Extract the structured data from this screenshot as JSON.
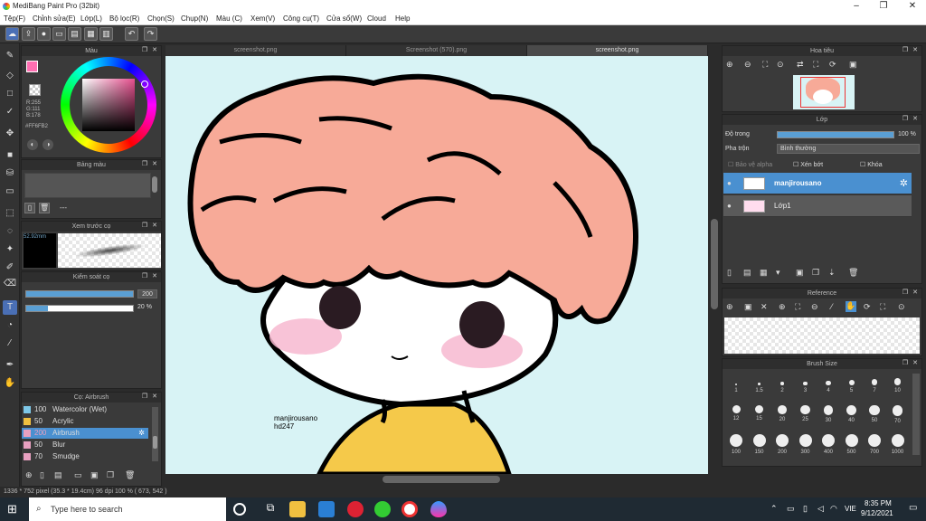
{
  "window": {
    "title": "MediBang Paint Pro (32bit)",
    "min": "–",
    "max": "❐",
    "close": "✕"
  },
  "menu": [
    "Tệp(F)",
    "Chỉnh sửa(E)",
    "Lớp(L)",
    "Bộ lọc(R)",
    "Chọn(S)",
    "Chụp(N)",
    "Màu (C)",
    "Xem(V)",
    "Công cụ(T)",
    "Cửa sổ(W)",
    "Cloud",
    "Help"
  ],
  "tabs": [
    "screenshot.png",
    "Screenshot (570).png",
    "screenshot.png"
  ],
  "color_panel": {
    "title": "Màu",
    "rgb": [
      "R:255",
      "G:111",
      "B:178"
    ],
    "hex": "#FF6FB2",
    "fg": "#ff6fb2"
  },
  "palette_panel": {
    "title": "Bảng màu",
    "dash": "---"
  },
  "preview_panel": {
    "title": "Xem trước cọ",
    "size": "52.92mm"
  },
  "control_panel": {
    "title": "Kiểm soát cọ",
    "size_val": "200",
    "opacity_val": "20 %",
    "size_fill": 1.0,
    "opacity_fill": 0.2
  },
  "brush_panel": {
    "title": "Cọ: Airbrush",
    "items": [
      {
        "size": "100",
        "name": "Watercolor (Wet)",
        "color": "#7ec8e8"
      },
      {
        "size": "50",
        "name": "Acrylic",
        "color": "#f0c040"
      },
      {
        "size": "200",
        "name": "Airbrush",
        "color": "#e8a0c0"
      },
      {
        "size": "50",
        "name": "Blur",
        "color": "#e8a0c0"
      },
      {
        "size": "70",
        "name": "Smudge",
        "color": "#e8a0c0"
      }
    ]
  },
  "navigator": {
    "title": "Hoa tiêu"
  },
  "layer_panel": {
    "title": "Lớp",
    "opacity_label": "Độ trong",
    "opacity_val": "100 %",
    "opacity_fill": 1.0,
    "blend_label": "Pha trộn",
    "blend_val": "Bình thường",
    "protect": "Bảo vệ alpha",
    "clip": "Xén bớt",
    "lock": "Khóa",
    "layers": [
      {
        "name": "manjirousano",
        "active": true
      },
      {
        "name": "Lớp1",
        "active": false
      }
    ]
  },
  "reference": {
    "title": "Reference"
  },
  "brushsize": {
    "title": "Brush Size",
    "rows": [
      [
        "1",
        "1.5",
        "2",
        "3",
        "4",
        "5",
        "7",
        "10"
      ],
      [
        "12",
        "15",
        "20",
        "25",
        "30",
        "40",
        "50",
        "70"
      ],
      [
        "100",
        "150",
        "200",
        "300",
        "400",
        "500",
        "700",
        "1000"
      ]
    ]
  },
  "canvas_text": {
    "line1": "manjirousano",
    "line2": "hd247"
  },
  "status": "1336 * 752 pixel  (35.3 * 19.4cm)  96 dpi  100 %  ( 673, 542 )",
  "taskbar": {
    "search": "Type here to search",
    "lang": "VIE",
    "time": "8:35 PM",
    "date": "9/12/2021"
  },
  "colors": {
    "hair": "#f7aa98",
    "shirt": "#f5c94a",
    "skin": "#ffffff",
    "blush": "#f7b8d0",
    "accent": "#4a90d0"
  }
}
